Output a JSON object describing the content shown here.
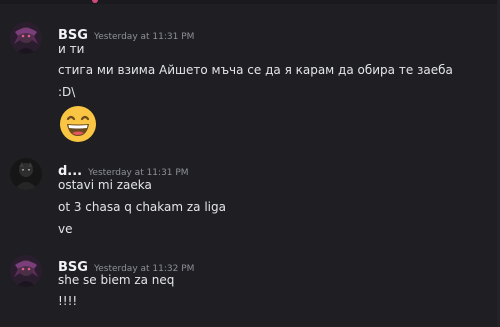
{
  "messages": [
    {
      "author": "BSG",
      "timestamp": "Yesterday at 11:31 PM",
      "avatar": "dark-anime-avatar",
      "lines": [
        "и ти",
        "стига ми взима Айшето мъча се да я карам да обира те заеба",
        ":D\\"
      ],
      "emoji": "grinning-face-with-smiling-eyes"
    },
    {
      "author": "d...",
      "timestamp": "Yesterday at 11:31 PM",
      "avatar": "dark-figure-avatar",
      "lines": [
        "ostavi mi zaeka",
        "ot 3 chasa q chakam za liga",
        "ve"
      ]
    },
    {
      "author": "BSG",
      "timestamp": "Yesterday at 11:32 PM",
      "avatar": "dark-anime-avatar",
      "lines": [
        "she se biem za neq",
        "!!!!"
      ]
    }
  ],
  "colors": {
    "background": "#1f1f23",
    "username": "#f2f3f5",
    "timestamp": "#8e9096",
    "text": "#e3e5e8"
  }
}
